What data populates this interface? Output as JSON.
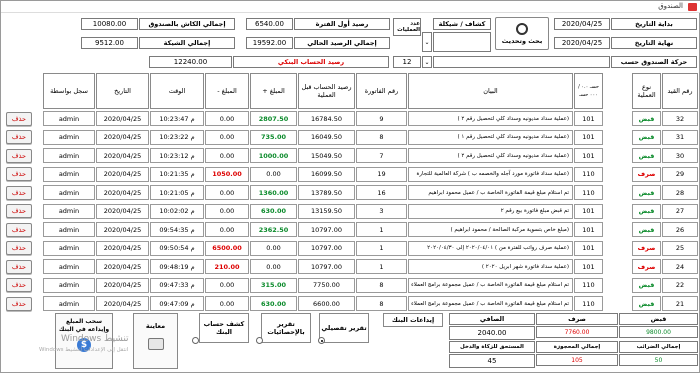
{
  "window": {
    "title": "الصندوق"
  },
  "filters": {
    "start_label": "بداية التاريخ",
    "start_value": "2020/04/25",
    "end_label": "نهاية التاريخ",
    "end_value": "2020/04/25",
    "search_label": "بحث وتحديث",
    "type_label": "كشاف / شيكلة",
    "ops_count_label": "عدد العمليات",
    "move_label": "حركة الصندوق حسب",
    "page_value": "12"
  },
  "summary": {
    "opening_label": "رصيد أول الفترة",
    "opening_value": "6540.00",
    "current_label": "إجمالي الرصيد الحالي",
    "current_value": "19592.00",
    "bank_label": "رصيد الحساب البنكي",
    "bank_value": "12240.00",
    "cash_total_label": "إجمالي الكاش بالصندوق",
    "cash_total_value": "10080.00",
    "check_total_label": "إجمالي الشيكة",
    "check_total_value": "9512.00"
  },
  "table": {
    "headers": {
      "id": "رقم القيد",
      "type": "نوع العملية",
      "account": "حسـ ٠.٠ / ٠٠٠ حسـ",
      "desc": "البيان",
      "invoice": "رقم الفاتورة",
      "before": "رصيد الحساب قبل العملية",
      "plus": "المبلغ +",
      "minus": "المبلغ -",
      "time": "الوقت",
      "date": "التاريخ",
      "user": "سجل بواسطة"
    },
    "delete_label": "حذف",
    "rows": [
      {
        "id": "32",
        "type": "قبض",
        "acc": "101",
        "desc": "(عملية سداد مديونيه وسداد كلي لتحصيل رقم ٢ )",
        "inv": "9",
        "before": "16784.50",
        "plus": "2807.50",
        "minus": "0.00",
        "time": "10:23:47 م",
        "date": "2020/04/25",
        "user": "admin"
      },
      {
        "id": "31",
        "type": "قبض",
        "acc": "101",
        "desc": "(عملية سداد مديونيه وسداد كلي لتحصيل رقم ١ )",
        "inv": "8",
        "before": "16049.50",
        "plus": "735.00",
        "minus": "0.00",
        "time": "10:23:22 م",
        "date": "2020/04/25",
        "user": "admin"
      },
      {
        "id": "30",
        "type": "قبض",
        "acc": "101",
        "desc": "(عملية سداد مديونيه وسداد كلي لتحصيل رقم ٢ )",
        "inv": "7",
        "before": "15049.50",
        "plus": "1000.00",
        "minus": "0.00",
        "time": "10:23:12 م",
        "date": "2020/04/25",
        "user": "admin"
      },
      {
        "id": "29",
        "type": "صرف",
        "acc": "110",
        "desc": "(عملية سداد فاتورة مورد آجله والخصمه ب ) شركة العالمية للتجارة",
        "inv": "19",
        "before": "16099.50",
        "plus": "0.00",
        "minus": "1050.00",
        "time": "10:21:35 م",
        "date": "2020/04/25",
        "user": "admin"
      },
      {
        "id": "28",
        "type": "قبض",
        "acc": "110",
        "desc": "تم استلام مبلغ قيمة الفاتورة الخاصة ب / عميل محمود ابراهيم",
        "inv": "16",
        "before": "13789.50",
        "plus": "1360.00",
        "minus": "0.00",
        "time": "10:21:05 م",
        "date": "2020/04/25",
        "user": "admin"
      },
      {
        "id": "27",
        "type": "قبض",
        "acc": "101",
        "desc": "تم قبض مبلغ فاتورة بيع رقم ٢",
        "inv": "3",
        "before": "13159.50",
        "plus": "630.00",
        "minus": "0.00",
        "time": "10:02:02 م",
        "date": "2020/04/25",
        "user": "admin"
      },
      {
        "id": "26",
        "type": "قبض",
        "acc": "101",
        "desc": "(مبلغ خاص بتسوية مركبة الصالحة / محمود ابراهيم )",
        "inv": "1",
        "before": "10797.00",
        "plus": "2362.50",
        "minus": "0.00",
        "time": "09:54:35 م",
        "date": "2020/04/25",
        "user": "admin"
      },
      {
        "id": "25",
        "type": "صرف",
        "acc": "101",
        "desc": "(عملية صرف رواتب للفترة من ) ٢٠٢٠/٠٤/٠١ إلى ٢٠٢٠/٠٤/٣٠",
        "inv": "1",
        "before": "10797.00",
        "plus": "0.00",
        "minus": "6500.00",
        "time": "09:50:54 م",
        "date": "2020/04/25",
        "user": "admin"
      },
      {
        "id": "24",
        "type": "صرف",
        "acc": "101",
        "desc": "(عملية سداد فاتورة شهر ابريل ٢٠٢٠ )",
        "inv": "1",
        "before": "10797.00",
        "plus": "0.00",
        "minus": "210.00",
        "time": "09:48:19 م",
        "date": "2020/04/25",
        "user": "admin"
      },
      {
        "id": "22",
        "type": "قبض",
        "acc": "110",
        "desc": "تم استلام مبلغ قيمة الفاتورة الخاصة ب / عميل مجموعة برامج العملاء",
        "inv": "8",
        "before": "7750.00",
        "plus": "315.00",
        "minus": "0.00",
        "time": "09:47:33 م",
        "date": "2020/04/25",
        "user": "admin"
      },
      {
        "id": "21",
        "type": "قبض",
        "acc": "110",
        "desc": "تم استلام مبلغ قيمة الفاتورة الخاصة ب / عميل مجموعة برامج العملاء",
        "inv": "8",
        "before": "6600.00",
        "plus": "630.00",
        "minus": "0.00",
        "time": "09:47:09 م",
        "date": "2020/04/25",
        "user": "admin"
      }
    ]
  },
  "bottom": {
    "receipt_label": "قبض",
    "receipt_value": "9800.00",
    "payment_label": "صرف",
    "payment_value": "7760.00",
    "net_label": "الصافي",
    "net_value": "2040.00",
    "bank_deposits_label": "إيداعات البنك",
    "tax_label": "إجمالي الضرائب",
    "tax_value": "50",
    "fees_label": "إجمالي المحجوزة",
    "fees_value": "105",
    "zakat_label": "المستحق للزكاة والدخل",
    "zakat_value": "45",
    "detail_report": "تقرير تفصيلي",
    "stats_report": "تقرير بالإحصائيات",
    "bank_statement": "كشف حساب البنك",
    "preview": "معاينة",
    "withdraw": "سحب المبلغ وإيداعه في البنك",
    "watermark1": "تنشيط Windows",
    "watermark2": "انتقل إلى الإعدادات لتنشيط Windows"
  }
}
